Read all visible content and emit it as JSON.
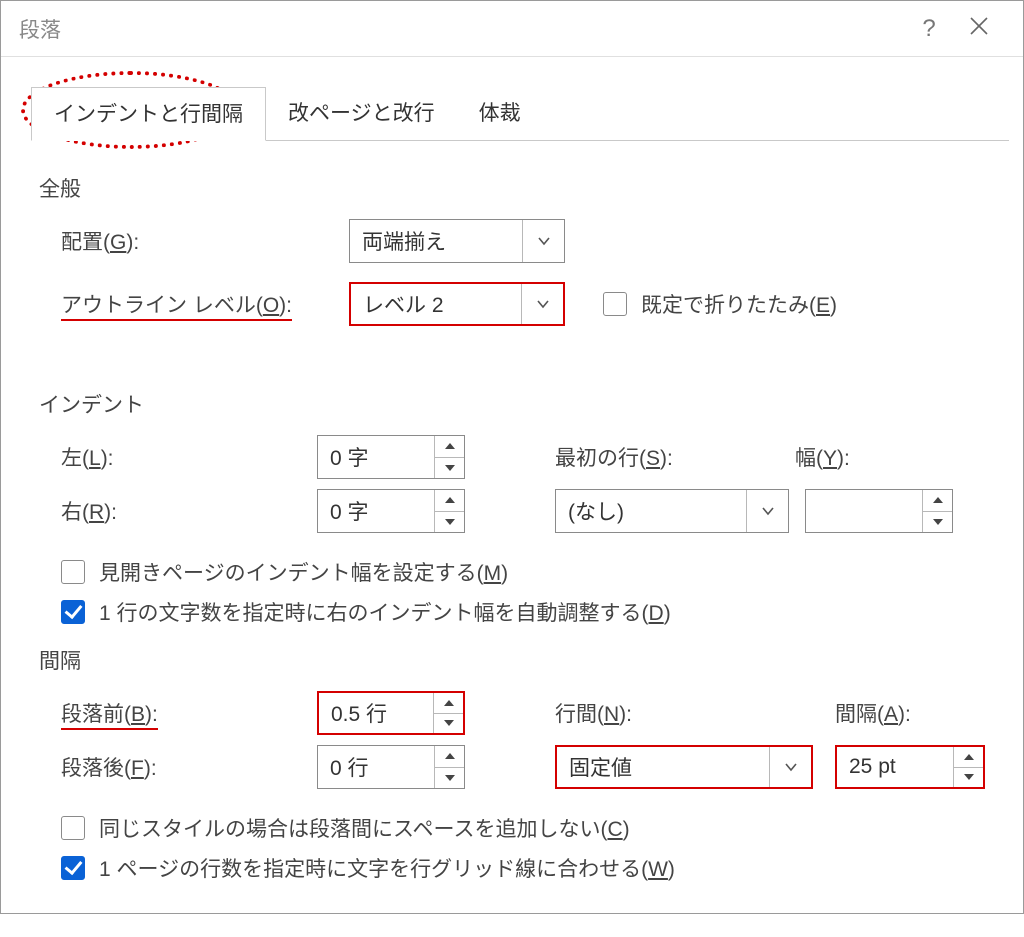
{
  "title": "段落",
  "tabs": {
    "indent_spacing": "インデントと行間隔",
    "page_break": "改ページと改行",
    "style": "体裁"
  },
  "general": {
    "heading": "全般",
    "alignment_label_pre": "配置(",
    "alignment_key": "G",
    "alignment_label_post": "):",
    "alignment_value": "両端揃え",
    "outline_label_pre": "アウトライン レベル(",
    "outline_key": "O",
    "outline_label_post": "):",
    "outline_value": "レベル 2",
    "collapse_label_pre": "既定で折りたたみ(",
    "collapse_key": "E",
    "collapse_label_post": ")"
  },
  "indent": {
    "heading": "インデント",
    "left_label_pre": "左(",
    "left_key": "L",
    "left_label_post": "):",
    "left_value": "0 字",
    "right_label_pre": "右(",
    "right_key": "R",
    "right_label_post": "):",
    "right_value": "0 字",
    "first_label_pre": "最初の行(",
    "first_key": "S",
    "first_label_post": "):",
    "first_value": "(なし)",
    "width_label_pre": "幅(",
    "width_key": "Y",
    "width_label_post": "):",
    "width_value": "",
    "mirror_label_pre": "見開きページのインデント幅を設定する(",
    "mirror_key": "M",
    "mirror_label_post": ")",
    "autoadjust_label_pre": "1 行の文字数を指定時に右のインデント幅を自動調整する(",
    "autoadjust_key": "D",
    "autoadjust_label_post": ")"
  },
  "spacing": {
    "heading": "間隔",
    "before_label_pre": "段落前(",
    "before_key": "B",
    "before_label_post": "):",
    "before_value": "0.5 行",
    "after_label_pre": "段落後(",
    "after_key": "F",
    "after_label_post": "):",
    "after_value": "0 行",
    "line_label_pre": "行間(",
    "line_key": "N",
    "line_label_post": "):",
    "line_value": "固定値",
    "at_label_pre": "間隔(",
    "at_key": "A",
    "at_label_post": "):",
    "at_value": "25 pt",
    "samestyle_label_pre": "同じスタイルの場合は段落間にスペースを追加しない(",
    "samestyle_key": "C",
    "samestyle_label_post": ")",
    "snapgrid_label_pre": "1 ページの行数を指定時に文字を行グリッド線に合わせる(",
    "snapgrid_key": "W",
    "snapgrid_label_post": ")"
  }
}
